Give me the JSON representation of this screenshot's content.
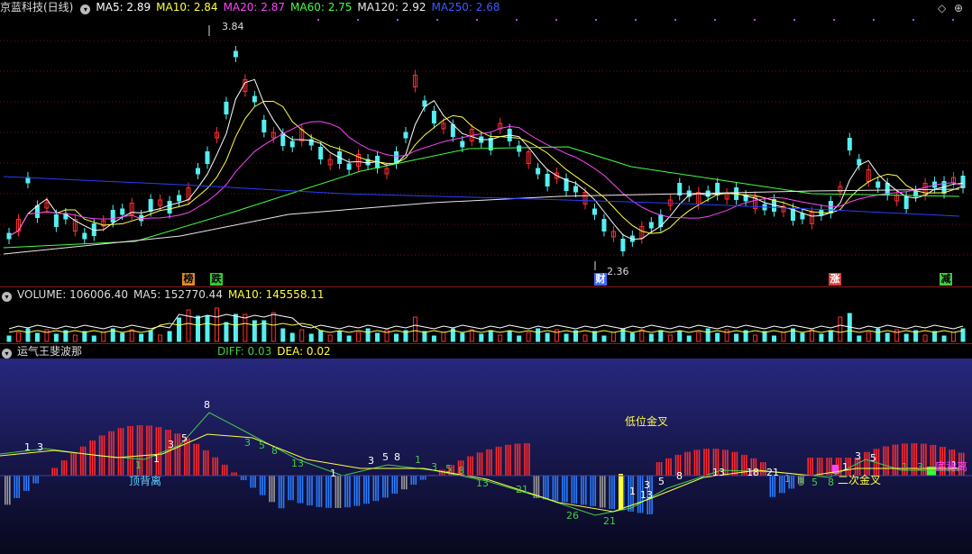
{
  "price_header": {
    "name": "京蓝科技(日线)",
    "ma5": "MA5: 2.89",
    "ma10": "MA10: 2.84",
    "ma20": "MA20: 2.87",
    "ma60": "MA60: 2.75",
    "ma120": "MA120: 2.92",
    "ma250": "MA250: 2.68"
  },
  "vol_header": {
    "volume": "VOLUME: 106006.40",
    "ma5": "MA5: 152770.44",
    "ma10": "MA10: 145558.11"
  },
  "ind_header": {
    "name": "运气王斐波那",
    "diff": "DIFF: 0.03",
    "dea": "DEA: 0.02"
  },
  "price_labels": {
    "high": "3.84",
    "low": "2.36"
  },
  "event_tags": [
    {
      "text": "榜",
      "color": "#e08a2a"
    },
    {
      "text": "跌",
      "color": "#33cc33"
    },
    {
      "text": "财",
      "color": "#3d6cff"
    },
    {
      "text": "涨",
      "color": "#d94040"
    },
    {
      "text": "减",
      "color": "#44cc44"
    }
  ],
  "ind_labels": {
    "top_divergence": "顶背离",
    "low_golden_cross": "低位金叉",
    "second_golden_cross": "二次金叉",
    "bottom_divergence": "底背离",
    "counts": [
      "1",
      "3",
      "8",
      "5",
      "3",
      "1",
      "1",
      "3",
      "5",
      "8",
      "13",
      "1",
      "3",
      "5",
      "8",
      "1",
      "3",
      "5",
      "8",
      "13",
      "21",
      "26",
      "21",
      "13",
      "1",
      "3",
      "5",
      "8",
      "13",
      "18",
      "21",
      "1",
      "3",
      "5",
      "8",
      "1",
      "3",
      "5",
      "1",
      "3",
      "1"
    ]
  },
  "colors": {
    "ma5": "#ffffff",
    "ma10": "#ffff44",
    "ma20": "#ff44ff",
    "ma60": "#44ff44",
    "ma120": "#e8e8e8",
    "ma250": "#2b3dff",
    "up": "#ff3030",
    "down": "#54f0f0",
    "diff": "#ffffff",
    "dea": "#ffff44"
  }
}
